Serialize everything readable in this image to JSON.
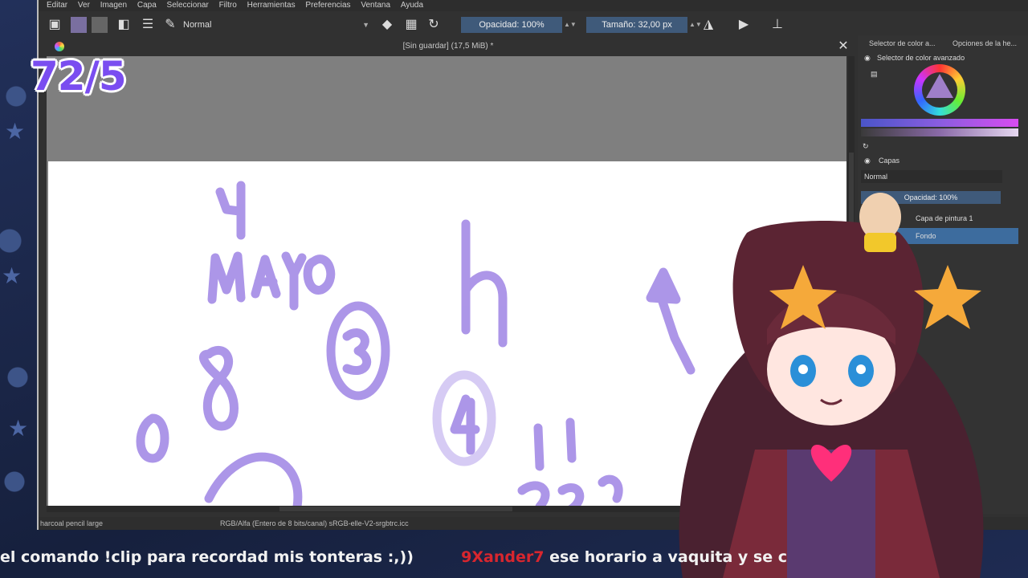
{
  "overlay": {
    "counter": "72/5",
    "ticker": {
      "message1": "el comando !clip para recordad mis tonteras :,))",
      "username": "9Xander7",
      "message2": "ese horario a vaquita y se c"
    }
  },
  "menubar": [
    "Editar",
    "Ver",
    "Imagen",
    "Capa",
    "Seleccionar",
    "Filtro",
    "Herramientas",
    "Preferencias",
    "Ventana",
    "Ayuda"
  ],
  "toolbar": {
    "blend_mode": "Normal",
    "opacity": "Opacidad: 100%",
    "size": "Tamaño: 32,00 px"
  },
  "document": {
    "title": "[Sin guardar]  (17,5 MiB) *"
  },
  "statusbar": {
    "brush": "harcoal pencil large",
    "color_space": "RGB/Alfa (Entero de 8 bits/canal)  sRGB-elle-V2-srgbtrc.icc"
  },
  "docker": {
    "tab_selector": "Selector de color a...",
    "tab_options": "Opciones de la he...",
    "color_header": "Selector de color avanzado",
    "layers_header": "Capas",
    "layer_blend": "Normal",
    "layer_opacity": "Opacidad:  100%",
    "layers": [
      "Capa de pintura 1",
      "Fondo"
    ]
  },
  "canvas_text": {
    "handwritten": [
      "4",
      "MAYO",
      "h",
      "3",
      "8",
      "4"
    ]
  },
  "colors": {
    "ink": "#a48be6",
    "counter": "#7a4df0",
    "username": "#d8262e"
  }
}
